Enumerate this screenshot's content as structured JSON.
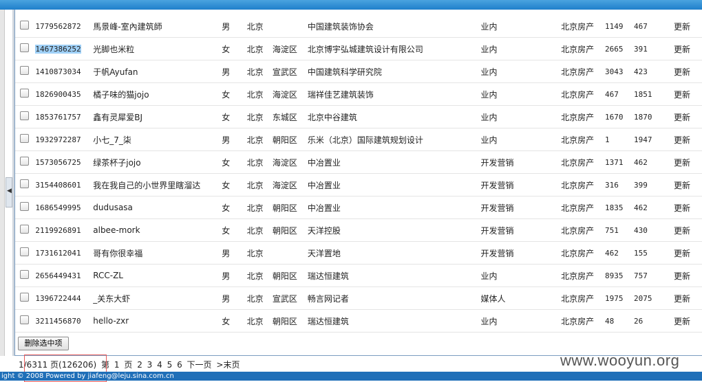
{
  "rows": [
    {
      "id": "1779562872",
      "name": "馬景峰-室內建筑師",
      "gender": "男",
      "city": "北京",
      "district": "",
      "company": "中国建筑装饰协会",
      "type": "业内",
      "site": "北京房产",
      "n1": "1149",
      "n2": "467",
      "action": "更新"
    },
    {
      "id": "1467386252",
      "name": "光脚也米粒",
      "gender": "女",
      "city": "北京",
      "district": "海淀区",
      "company": "北京博宇弘城建筑设计有限公司",
      "type": "业内",
      "site": "北京房产",
      "n1": "2665",
      "n2": "391",
      "action": "更新"
    },
    {
      "id": "1410873034",
      "name": "于帆Ayufan",
      "gender": "男",
      "city": "北京",
      "district": "宣武区",
      "company": "中国建筑科学研究院",
      "type": "业内",
      "site": "北京房产",
      "n1": "3043",
      "n2": "423",
      "action": "更新"
    },
    {
      "id": "1826900435",
      "name": "橘子味的猫jojo",
      "gender": "女",
      "city": "北京",
      "district": "海淀区",
      "company": "瑞祥佳艺建筑装饰",
      "type": "业内",
      "site": "北京房产",
      "n1": "467",
      "n2": "1851",
      "action": "更新"
    },
    {
      "id": "1853761757",
      "name": "鑫有灵犀爱BJ",
      "gender": "女",
      "city": "北京",
      "district": "东城区",
      "company": "北京中谷建筑",
      "type": "业内",
      "site": "北京房产",
      "n1": "1670",
      "n2": "1870",
      "action": "更新"
    },
    {
      "id": "1932972287",
      "name": "小七_7_柒",
      "gender": "男",
      "city": "北京",
      "district": "朝阳区",
      "company": "乐米（北京）国际建筑规划设计",
      "type": "业内",
      "site": "北京房产",
      "n1": "1",
      "n2": "1947",
      "action": "更新"
    },
    {
      "id": "1573056725",
      "name": "绿茶杯子jojo",
      "gender": "女",
      "city": "北京",
      "district": "海淀区",
      "company": "中冶置业",
      "type": "开发营销",
      "site": "北京房产",
      "n1": "1371",
      "n2": "462",
      "action": "更新"
    },
    {
      "id": "3154408601",
      "name": "我在我自己的小世界里瞎溜达",
      "gender": "女",
      "city": "北京",
      "district": "海淀区",
      "company": "中冶置业",
      "type": "开发营销",
      "site": "北京房产",
      "n1": "316",
      "n2": "399",
      "action": "更新"
    },
    {
      "id": "1686549995",
      "name": "dudusasa",
      "gender": "女",
      "city": "北京",
      "district": "朝阳区",
      "company": "中冶置业",
      "type": "开发营销",
      "site": "北京房产",
      "n1": "1835",
      "n2": "462",
      "action": "更新"
    },
    {
      "id": "2119926891",
      "name": "albee-mork",
      "gender": "女",
      "city": "北京",
      "district": "朝阳区",
      "company": "天洋控股",
      "type": "开发营销",
      "site": "北京房产",
      "n1": "751",
      "n2": "430",
      "action": "更新"
    },
    {
      "id": "1731612041",
      "name": "哥有你很幸福",
      "gender": "男",
      "city": "北京",
      "district": "",
      "company": "天洋置地",
      "type": "开发营销",
      "site": "北京房产",
      "n1": "462",
      "n2": "155",
      "action": "更新"
    },
    {
      "id": "2656449431",
      "name": "RCC-ZL",
      "gender": "男",
      "city": "北京",
      "district": "朝阳区",
      "company": "瑞达恒建筑",
      "type": "业内",
      "site": "北京房产",
      "n1": "8935",
      "n2": "757",
      "action": "更新"
    },
    {
      "id": "1396722444",
      "name": "_关东大虾",
      "gender": "男",
      "city": "北京",
      "district": "宣武区",
      "company": "畅言网记者",
      "type": "媒体人",
      "site": "北京房产",
      "n1": "1975",
      "n2": "2075",
      "action": "更新"
    },
    {
      "id": "3211456870",
      "name": "hello-zxr",
      "gender": "女",
      "city": "北京",
      "district": "朝阳区",
      "company": "瑞达恒建筑",
      "type": "业内",
      "site": "北京房产",
      "n1": "48",
      "n2": "26",
      "action": "更新"
    }
  ],
  "delete_button": "删除选中项",
  "pager": {
    "summary": "1/6311 页(126206)",
    "prefix": "第",
    "pages": [
      "1",
      "2",
      "3",
      "4",
      "5",
      "6"
    ],
    "suffix": "页",
    "next": "下一页",
    "last": ">末页"
  },
  "watermark": "www.wooyun.org",
  "footer": "ight © 2008    Powered by jiafeng@leju.sina.com.cn"
}
